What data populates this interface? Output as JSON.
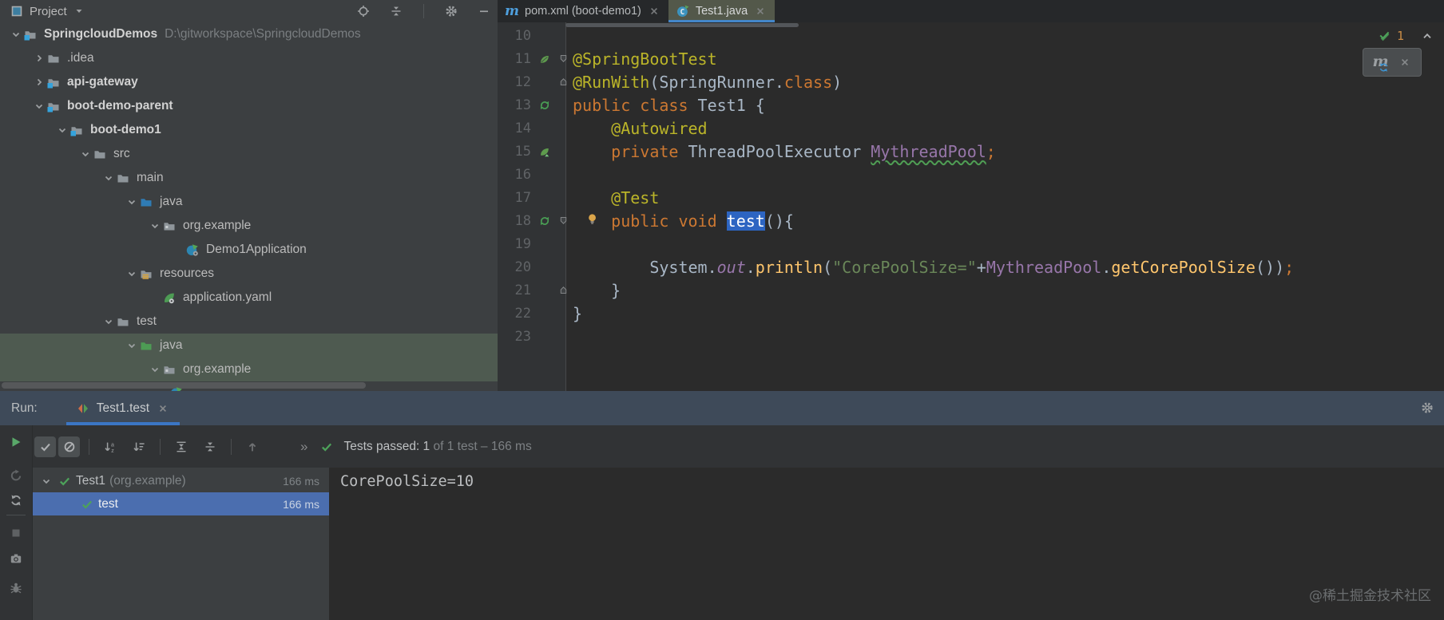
{
  "icons": {
    "maven_m": "m"
  },
  "project_panel": {
    "title": "Project",
    "tree": [
      {
        "chevron": "down",
        "icon": "folder-module",
        "label": "SpringcloudDemos",
        "bold": true,
        "suffix": "D:\\gitworkspace\\SpringcloudDemos",
        "level": 0
      },
      {
        "chevron": "right",
        "icon": "folder",
        "label": ".idea",
        "level": 1
      },
      {
        "chevron": "right",
        "icon": "folder-module",
        "label": "api-gateway",
        "bold": true,
        "level": 1
      },
      {
        "chevron": "down",
        "icon": "folder-module",
        "label": "boot-demo-parent",
        "bold": true,
        "level": 1
      },
      {
        "chevron": "down",
        "icon": "folder-module",
        "label": "boot-demo1",
        "bold": true,
        "level": 2
      },
      {
        "chevron": "down",
        "icon": "folder",
        "label": "src",
        "level": 3
      },
      {
        "chevron": "down",
        "icon": "folder",
        "label": "main",
        "level": 4
      },
      {
        "chevron": "down",
        "icon": "folder-source",
        "label": "java",
        "level": 5
      },
      {
        "chevron": "down",
        "icon": "package",
        "label": "org.example",
        "level": 6
      },
      {
        "chevron": "none",
        "icon": "springboot",
        "label": "Demo1Application",
        "level": 7
      },
      {
        "chevron": "down",
        "icon": "folder-resources",
        "label": "resources",
        "level": 5
      },
      {
        "chevron": "none",
        "icon": "spring-yaml",
        "label": "application.yaml",
        "level": 6
      },
      {
        "chevron": "down",
        "icon": "folder",
        "label": "test",
        "level": 4
      },
      {
        "chevron": "down",
        "icon": "folder-test",
        "label": "java",
        "level": 5,
        "selected": true
      },
      {
        "chevron": "down",
        "icon": "package",
        "label": "org.example",
        "level": 6,
        "selected": true
      }
    ]
  },
  "editor": {
    "tabs": [
      {
        "icon": "maven",
        "label": "pom.xml (boot-demo1)",
        "active": false
      },
      {
        "icon": "test-class",
        "label": "Test1.java",
        "active": true
      }
    ],
    "inspections": {
      "ok_count": "1"
    },
    "lines": [
      {
        "n": "10",
        "tok": []
      },
      {
        "n": "11",
        "g": "leaf",
        "fold": "down",
        "tok": [
          [
            "ann",
            "@SpringBootTest"
          ]
        ]
      },
      {
        "n": "12",
        "fold": "up",
        "tok": [
          [
            "ann",
            "@RunWith"
          ],
          [
            "def",
            "("
          ],
          [
            "def",
            "SpringRunner."
          ],
          [
            "kw",
            "class"
          ],
          [
            "def",
            ")"
          ]
        ]
      },
      {
        "n": "13",
        "g": "run",
        "tok": [
          [
            "kw",
            "public class "
          ],
          [
            "def",
            "Test1 {"
          ]
        ]
      },
      {
        "n": "14",
        "tok": [
          [
            "ann",
            "    @Autowired"
          ]
        ]
      },
      {
        "n": "15",
        "g": "bean",
        "tok": [
          [
            "kw",
            "    private "
          ],
          [
            "def",
            "ThreadPoolExecutor "
          ],
          [
            "fldw",
            "MythreadPool"
          ],
          [
            "smc",
            ";"
          ]
        ]
      },
      {
        "n": "16",
        "tok": []
      },
      {
        "n": "17",
        "tok": [
          [
            "ann",
            "    @Test"
          ]
        ]
      },
      {
        "n": "18",
        "g": "run",
        "fold": "down",
        "bulb": true,
        "tok": [
          [
            "kw",
            "    public void "
          ],
          [
            "sel",
            "test"
          ],
          [
            "def",
            "(){"
          ]
        ]
      },
      {
        "n": "19",
        "tok": []
      },
      {
        "n": "20",
        "tok": [
          [
            "def",
            "        System."
          ],
          [
            "sfl",
            "out"
          ],
          [
            "def",
            "."
          ],
          [
            "mth",
            "println"
          ],
          [
            "def",
            "("
          ],
          [
            "str",
            "\"CorePoolSize=\""
          ],
          [
            "def",
            "+"
          ],
          [
            "fld",
            "MythreadPool"
          ],
          [
            "def",
            "."
          ],
          [
            "mth",
            "getCorePoolSize"
          ],
          [
            "def",
            "())"
          ],
          [
            "smc",
            ";"
          ]
        ]
      },
      {
        "n": "21",
        "fold": "up",
        "tok": [
          [
            "def",
            "    }"
          ]
        ]
      },
      {
        "n": "22",
        "tok": [
          [
            "def",
            "}"
          ]
        ]
      },
      {
        "n": "23",
        "tok": []
      }
    ]
  },
  "run_panel": {
    "label": "Run:",
    "tab_label": "Test1.test",
    "toolbar": {
      "status_strong": "Tests passed: 1",
      "status_muted": "of 1 test – 166 ms"
    },
    "tests": [
      {
        "name": "Test1",
        "pkg": "(org.example)",
        "time": "166 ms",
        "level": 0,
        "chevron": true,
        "selected": false
      },
      {
        "name": "test",
        "pkg": "",
        "time": "166 ms",
        "level": 1,
        "chevron": false,
        "selected": true
      }
    ],
    "console": [
      "CorePoolSize=10"
    ]
  },
  "watermark": "@稀土掘金技术社区"
}
